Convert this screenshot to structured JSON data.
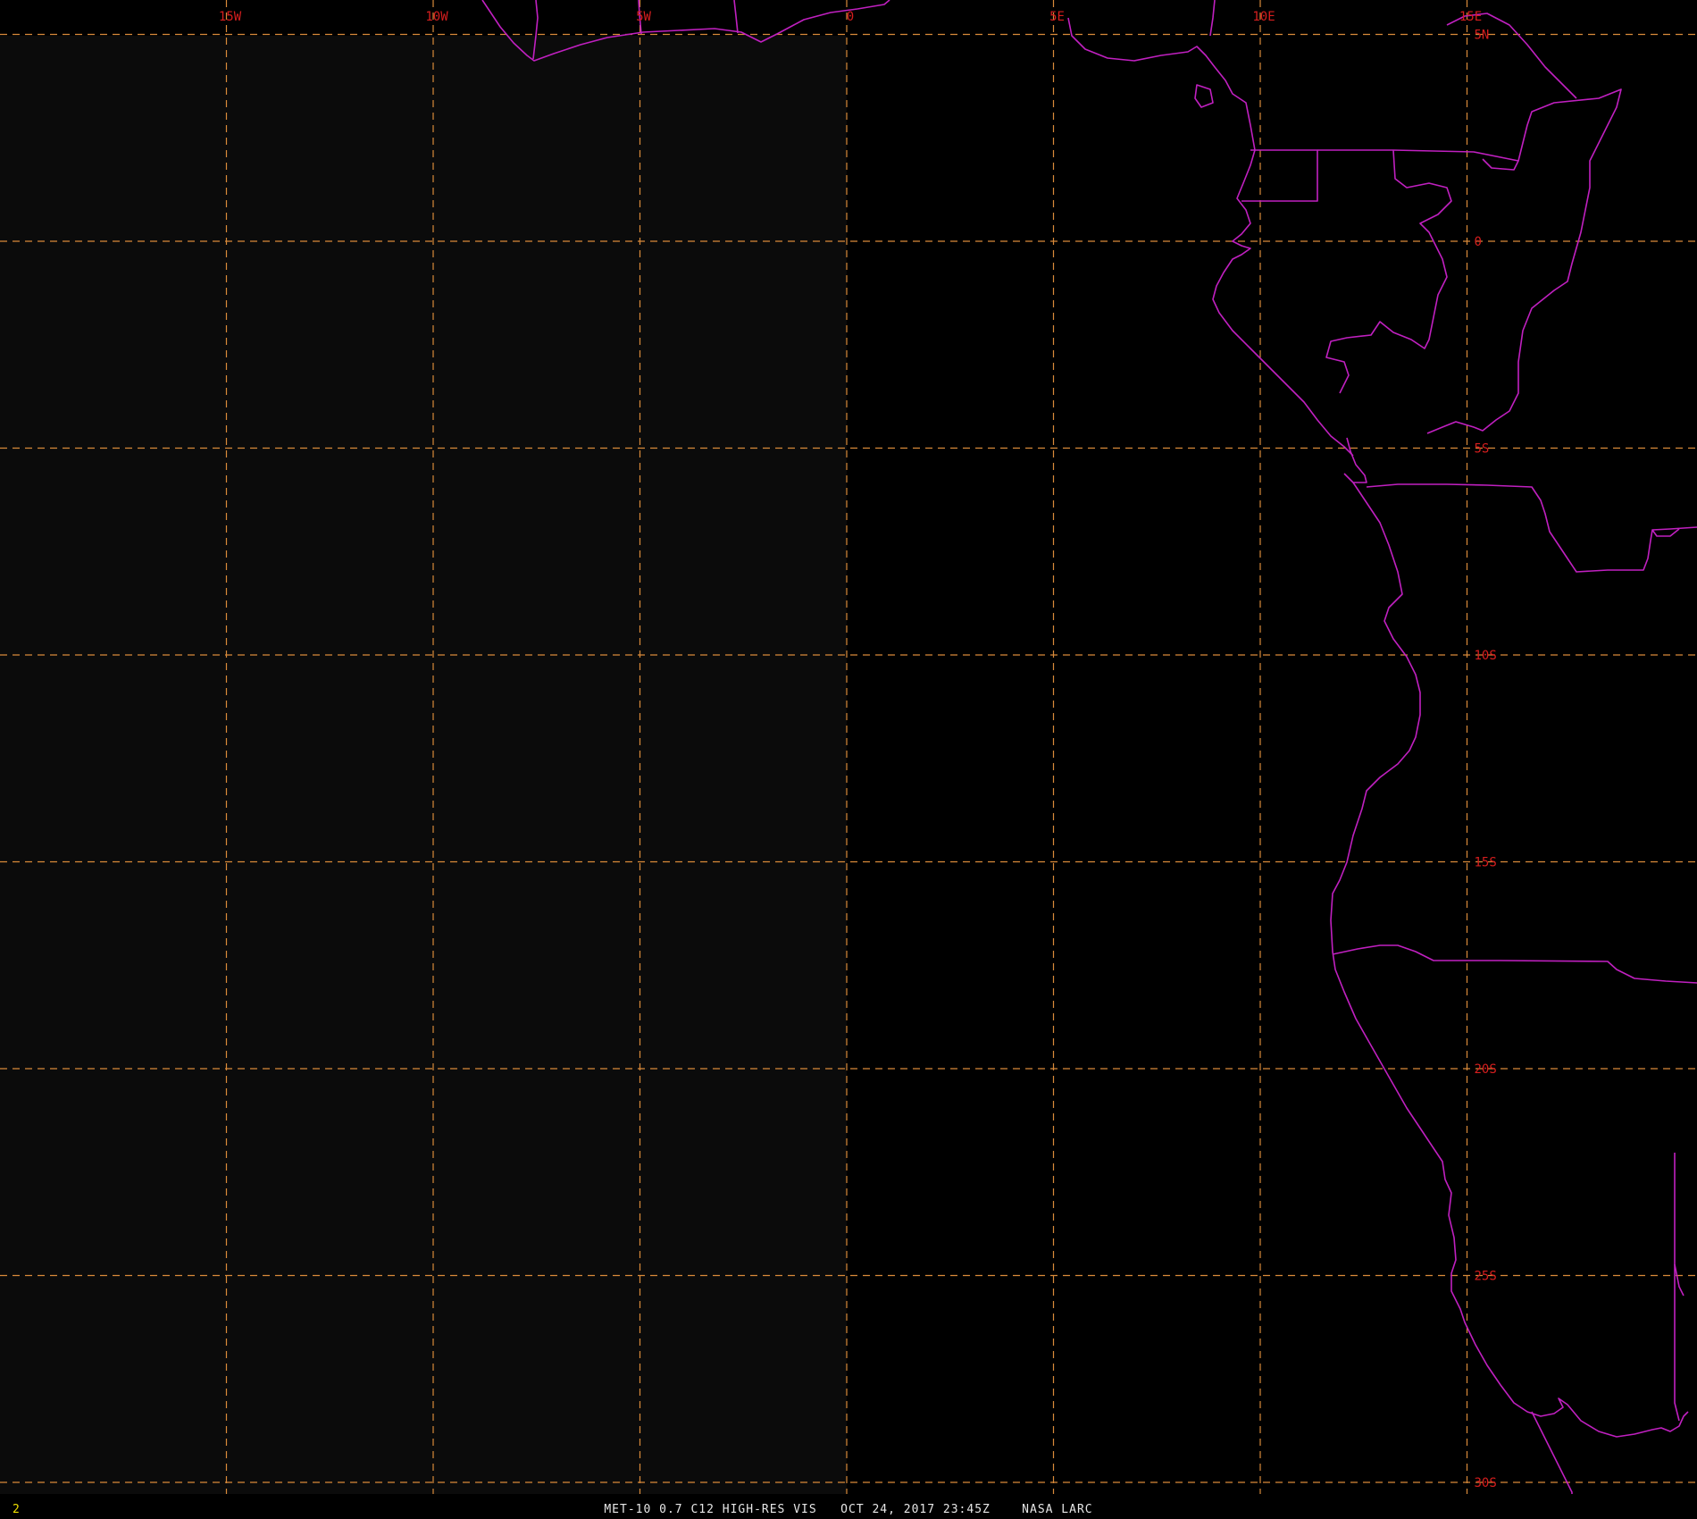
{
  "product_caption": "MET-10 0.7 C12 HIGH-RES VIS   OCT 24, 2017 23:45Z    NASA LARC",
  "frame_number": "2",
  "colors": {
    "background": "#000000",
    "dim_region": "#0b0b0b",
    "graticule": "#d98a3a",
    "graticule_label": "#d61e1e",
    "coastline": "#c020c0",
    "footer_text": "#e6e6e6",
    "frame_number": "#f0e000"
  },
  "graticule": {
    "longitudes": [
      {
        "deg": -15,
        "label": "15W"
      },
      {
        "deg": -10,
        "label": "10W"
      },
      {
        "deg": -5,
        "label": "5W"
      },
      {
        "deg": 0,
        "label": "0"
      },
      {
        "deg": 5,
        "label": "5E"
      },
      {
        "deg": 10,
        "label": "10E"
      },
      {
        "deg": 15,
        "label": "15E"
      }
    ],
    "latitudes": [
      {
        "deg": 5,
        "label": "5N"
      },
      {
        "deg": 0,
        "label": "0"
      },
      {
        "deg": -5,
        "label": "5S"
      },
      {
        "deg": -10,
        "label": "10S"
      },
      {
        "deg": -15,
        "label": "15S"
      },
      {
        "deg": -20,
        "label": "20S"
      },
      {
        "deg": -25,
        "label": "25S"
      },
      {
        "deg": -30,
        "label": "30S"
      }
    ]
  }
}
